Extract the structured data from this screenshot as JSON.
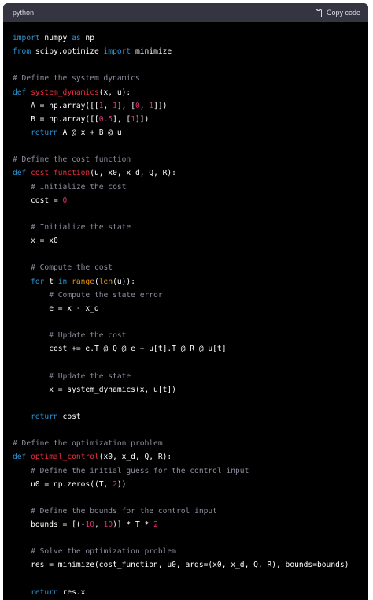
{
  "header": {
    "language": "python",
    "copy_label": "Copy code",
    "copy_icon": "clipboard-icon"
  },
  "colors": {
    "background": "#000000",
    "header_bg": "#343541",
    "keyword": "#2e95d3",
    "function_name": "#f22c3d",
    "comment": "#8e8ea0",
    "number": "#df3079",
    "builtin": "#e9950c",
    "text": "#ffffff"
  },
  "code_lines": [
    [
      [
        "kw",
        "import"
      ],
      [
        "tx",
        " numpy "
      ],
      [
        "kw",
        "as"
      ],
      [
        "tx",
        " np"
      ]
    ],
    [
      [
        "kw",
        "from"
      ],
      [
        "tx",
        " scipy.optimize "
      ],
      [
        "kw",
        "import"
      ],
      [
        "tx",
        " minimize"
      ]
    ],
    [],
    [
      [
        "cm",
        "# Define the system dynamics"
      ]
    ],
    [
      [
        "kw",
        "def"
      ],
      [
        "tx",
        " "
      ],
      [
        "fn",
        "system_dynamics"
      ],
      [
        "tx",
        "(x, u):"
      ]
    ],
    [
      [
        "tx",
        "    A = np.array([["
      ],
      [
        "num",
        "1"
      ],
      [
        "tx",
        ", "
      ],
      [
        "num",
        "1"
      ],
      [
        "tx",
        "], ["
      ],
      [
        "num",
        "0"
      ],
      [
        "tx",
        ", "
      ],
      [
        "num",
        "1"
      ],
      [
        "tx",
        "]])"
      ]
    ],
    [
      [
        "tx",
        "    B = np.array([["
      ],
      [
        "num",
        "0.5"
      ],
      [
        "tx",
        "], ["
      ],
      [
        "num",
        "1"
      ],
      [
        "tx",
        "]])"
      ]
    ],
    [
      [
        "tx",
        "    "
      ],
      [
        "kw",
        "return"
      ],
      [
        "tx",
        " A @ x + B @ u"
      ]
    ],
    [],
    [
      [
        "cm",
        "# Define the cost function"
      ]
    ],
    [
      [
        "kw",
        "def"
      ],
      [
        "tx",
        " "
      ],
      [
        "fn",
        "cost_function"
      ],
      [
        "tx",
        "(u, x0, x_d, Q, R):"
      ]
    ],
    [
      [
        "tx",
        "    "
      ],
      [
        "cm",
        "# Initialize the cost"
      ]
    ],
    [
      [
        "tx",
        "    cost = "
      ],
      [
        "num",
        "0"
      ]
    ],
    [],
    [
      [
        "tx",
        "    "
      ],
      [
        "cm",
        "# Initialize the state"
      ]
    ],
    [
      [
        "tx",
        "    x = x0"
      ]
    ],
    [],
    [
      [
        "tx",
        "    "
      ],
      [
        "cm",
        "# Compute the cost"
      ]
    ],
    [
      [
        "tx",
        "    "
      ],
      [
        "kw",
        "for"
      ],
      [
        "tx",
        " t "
      ],
      [
        "kw",
        "in"
      ],
      [
        "tx",
        " "
      ],
      [
        "bi",
        "range"
      ],
      [
        "tx",
        "("
      ],
      [
        "bi",
        "len"
      ],
      [
        "tx",
        "(u)):"
      ]
    ],
    [
      [
        "tx",
        "        "
      ],
      [
        "cm",
        "# Compute the state error"
      ]
    ],
    [
      [
        "tx",
        "        e = x - x_d"
      ]
    ],
    [],
    [
      [
        "tx",
        "        "
      ],
      [
        "cm",
        "# Update the cost"
      ]
    ],
    [
      [
        "tx",
        "        cost += e.T @ Q @ e + u[t].T @ R @ u[t]"
      ]
    ],
    [],
    [
      [
        "tx",
        "        "
      ],
      [
        "cm",
        "# Update the state"
      ]
    ],
    [
      [
        "tx",
        "        x = system_dynamics(x, u[t])"
      ]
    ],
    [],
    [
      [
        "tx",
        "    "
      ],
      [
        "kw",
        "return"
      ],
      [
        "tx",
        " cost"
      ]
    ],
    [],
    [
      [
        "cm",
        "# Define the optimization problem"
      ]
    ],
    [
      [
        "kw",
        "def"
      ],
      [
        "tx",
        " "
      ],
      [
        "fn",
        "optimal_control"
      ],
      [
        "tx",
        "(x0, x_d, Q, R):"
      ]
    ],
    [
      [
        "tx",
        "    "
      ],
      [
        "cm",
        "# Define the initial guess for the control input"
      ]
    ],
    [
      [
        "tx",
        "    u0 = np.zeros((T, "
      ],
      [
        "num",
        "2"
      ],
      [
        "tx",
        "))"
      ]
    ],
    [],
    [
      [
        "tx",
        "    "
      ],
      [
        "cm",
        "# Define the bounds for the control input"
      ]
    ],
    [
      [
        "tx",
        "    bounds = [(-"
      ],
      [
        "num",
        "10"
      ],
      [
        "tx",
        ", "
      ],
      [
        "num",
        "10"
      ],
      [
        "tx",
        ")] * T * "
      ],
      [
        "num",
        "2"
      ]
    ],
    [],
    [
      [
        "tx",
        "    "
      ],
      [
        "cm",
        "# Solve the optimization problem"
      ]
    ],
    [
      [
        "tx",
        "    res = minimize(cost_function, u0, args=(x0, x_d, Q, R), bounds=bounds)"
      ]
    ],
    [],
    [
      [
        "tx",
        "    "
      ],
      [
        "kw",
        "return"
      ],
      [
        "tx",
        " res.x"
      ]
    ]
  ]
}
